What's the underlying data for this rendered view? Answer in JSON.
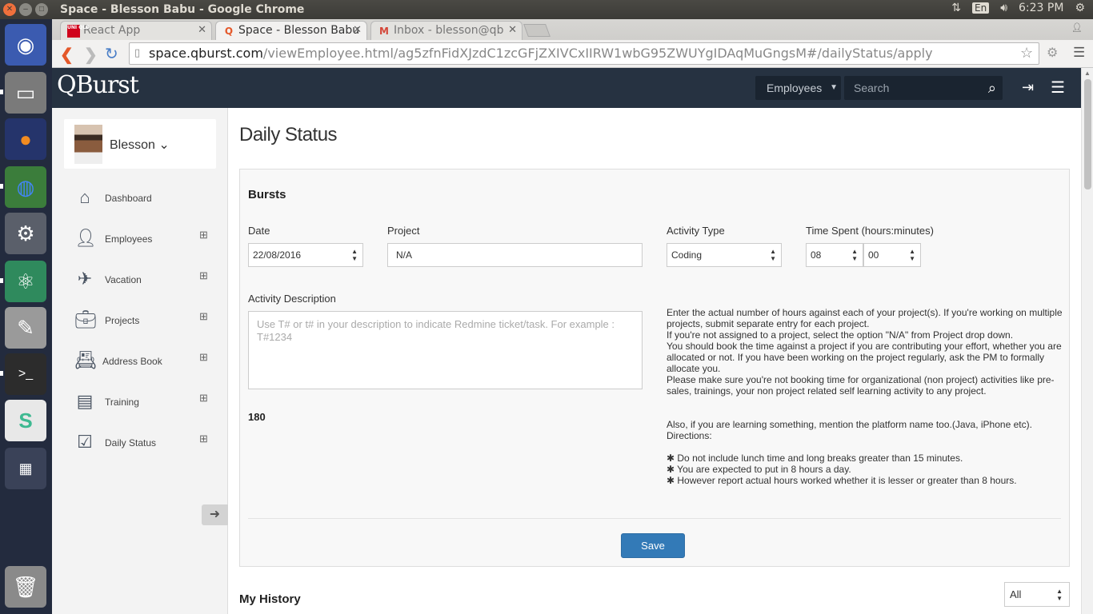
{
  "os": {
    "window_title": "Space - Blesson Babu - Google Chrome",
    "keyboard_lang": "En",
    "clock": "6:23 PM"
  },
  "browser": {
    "tabs": [
      {
        "label": "React App",
        "favicon": "UNI QLO",
        "favicon_color": "#d0021b"
      },
      {
        "label": "Space - Blesson Babu",
        "favicon": "Q",
        "favicon_color": "#e4582a"
      },
      {
        "label": "Inbox - blesson@qb",
        "favicon": "M",
        "favicon_color": "#d44638"
      }
    ],
    "url_host": "space.qburst.com",
    "url_path": "/viewEmployee.html/ag5zfnFidXJzdC1zcGFjZXIVCxIIRW1wbG95ZWUYgIDAqMuGngsM#/dailyStatus/apply"
  },
  "app": {
    "logo": "QBurst",
    "nav_select": "Employees",
    "search_placeholder": "Search",
    "user_name": "Blesson",
    "menu": [
      {
        "label": "Dashboard",
        "icon": "home-icon"
      },
      {
        "label": "Employees",
        "icon": "person-icon"
      },
      {
        "label": "Vacation",
        "icon": "plane-icon"
      },
      {
        "label": "Projects",
        "icon": "briefcase-icon"
      },
      {
        "label": "Address Book",
        "icon": "address-book-icon"
      },
      {
        "label": "Training",
        "icon": "training-icon"
      },
      {
        "label": "Daily Status",
        "icon": "checklist-icon"
      }
    ]
  },
  "main": {
    "title": "Daily Status",
    "panel_heading": "Bursts",
    "date_label": "Date",
    "date_value": "22/08/2016",
    "project_label": "Project",
    "project_value": "N/A",
    "activity_type_label": "Activity Type",
    "activity_type_value": "Coding",
    "time_label": "Time Spent (hours:minutes)",
    "hours_value": "08",
    "minutes_value": "00",
    "desc_label": "Activity Description",
    "desc_placeholder": "Use T# or t# in your description to indicate Redmine ticket/task. For example : T#1234",
    "char_count": "180",
    "help": [
      "Enter the actual number of hours against each of your project(s). If you're working on multiple projects, submit separate entry for each project.",
      "If you're not assigned to a project, select the option \"N/A\" from Project drop down.",
      "You should book the time against a project if you are contributing your effort, whether you are allocated or not. If you have been working on the project regularly, ask the PM to formally allocate you.",
      "Please make sure you're not booking time for organizational (non project) activities like pre-sales, trainings, your non project related self learning activity to any project."
    ],
    "help_learning": "Also, if you are learning something, mention the platform name too.(Java, iPhone etc).",
    "help_directions": "Directions:",
    "directions": [
      "✱ Do not include lunch time and long breaks greater than 15 minutes.",
      "✱ You are expected to put in 8 hours a day.",
      "✱ However report actual hours worked whether it is lesser or greater than 8 hours."
    ],
    "save_label": "Save",
    "history_title": "My History",
    "history_filter": "All"
  }
}
